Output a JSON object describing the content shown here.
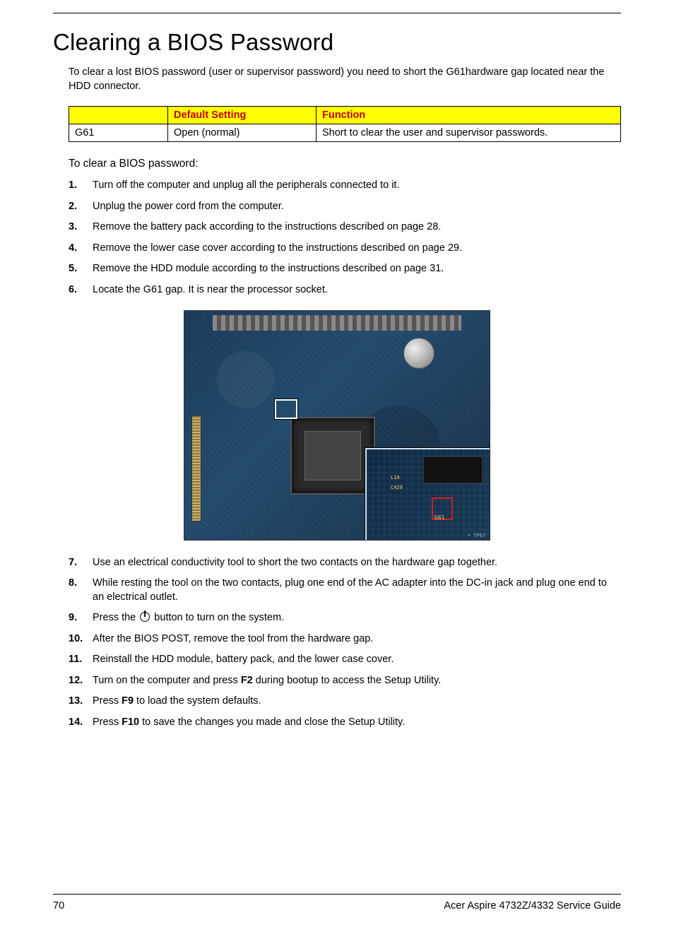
{
  "title": "Clearing a BIOS Password",
  "intro": "To clear a lost BIOS password (user or supervisor password) you need to short the G61hardware gap located near the HDD connector.",
  "table": {
    "headers": [
      "",
      "Default Setting",
      "Function"
    ],
    "row": {
      "name": "G61",
      "default": "Open (normal)",
      "function": "Short to clear the user and supervisor passwords."
    }
  },
  "subhead": "To clear a BIOS password:",
  "steps_a": [
    "Turn off the computer and unplug all the peripherals connected to it.",
    "Unplug the power cord from the computer.",
    "Remove the battery pack according to the instructions described on page 28.",
    "Remove the lower case cover according to the instructions described on page 29.",
    "Remove the HDD module according to the instructions described on page 31.",
    "Locate the G61 gap. It is near the processor socket."
  ],
  "steps_b": [
    "Use an electrical conductivity tool to short the two contacts on the hardware gap together.",
    "While resting the tool on the two contacts, plug one end of the AC adapter into the DC-in jack and plug one end to an electrical outlet."
  ],
  "step9_pre": "Press the ",
  "step9_post": " button to turn on the system.",
  "steps_c": [
    "After the BIOS POST, remove the tool from the hardware gap.",
    "Reinstall the HDD module, battery pack, and the lower case cover."
  ],
  "step12_pre": "Turn on the computer and press ",
  "step12_key": "F2",
  "step12_post": " during bootup to access the Setup Utility.",
  "step13_pre": "Press ",
  "step13_key": "F9",
  "step13_post": " to load the system defaults.",
  "step14_pre": "Press ",
  "step14_key": "F10",
  "step14_post": " to save the changes you made and close the Setup Utility.",
  "callout_labels": {
    "g61": "G61",
    "c1": "L19",
    "c2": "C429",
    "tp": "• TP67"
  },
  "footer": {
    "page": "70",
    "doc": "Acer Aspire 4732Z/4332 Service Guide"
  }
}
